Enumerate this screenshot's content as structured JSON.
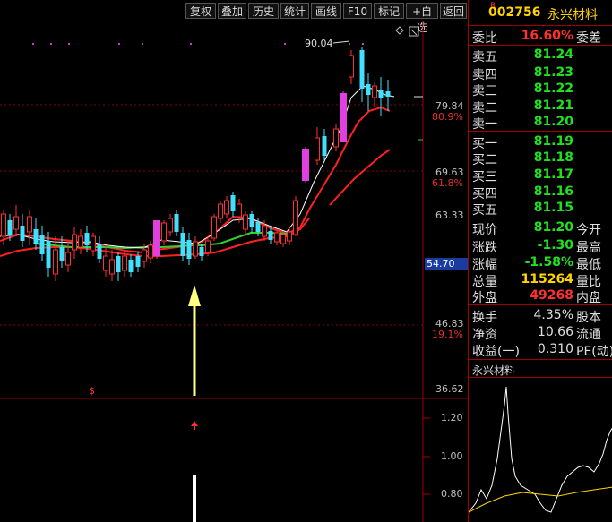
{
  "toolbar": {
    "buttons": [
      "复权",
      "叠加",
      "历史",
      "统计",
      "画线",
      "F10",
      "标记",
      "+自选",
      "返回"
    ]
  },
  "chart": {
    "peak_label": "90.04",
    "axis_labels": [
      {
        "value": "79.84",
        "pct": "80.9%"
      },
      {
        "value": "69.63",
        "pct": "61.8%"
      },
      {
        "value": "63.33",
        "pct": ""
      },
      {
        "value": "46.83",
        "pct": "19.1%"
      },
      {
        "value": "36.62",
        "pct": ""
      }
    ],
    "current_price_tag": "54.70",
    "signal_label": "$",
    "sub_axis": [
      "1.20",
      "1.00",
      "0.80"
    ]
  },
  "quote": {
    "r_mark": "R",
    "code": "002756",
    "name": "永兴材料",
    "wei_bi": {
      "label": "委比",
      "value": "16.60%",
      "tail": "委差"
    },
    "sell": [
      {
        "label": "卖五",
        "price": "81.24"
      },
      {
        "label": "卖四",
        "price": "81.23"
      },
      {
        "label": "卖三",
        "price": "81.22"
      },
      {
        "label": "卖二",
        "price": "81.21"
      },
      {
        "label": "卖一",
        "price": "81.20"
      }
    ],
    "buy": [
      {
        "label": "买一",
        "price": "81.19"
      },
      {
        "label": "买二",
        "price": "81.18"
      },
      {
        "label": "买三",
        "price": "81.17"
      },
      {
        "label": "买四",
        "price": "81.16"
      },
      {
        "label": "买五",
        "price": "81.15"
      }
    ],
    "stats": [
      {
        "label": "现价",
        "value": "81.20",
        "tail": "今开",
        "color": "#20e020"
      },
      {
        "label": "涨跌",
        "value": "-1.30",
        "tail": "最高",
        "color": "#20e020"
      },
      {
        "label": "涨幅",
        "value": "-1.58%",
        "tail": "最低",
        "color": "#20e020"
      },
      {
        "label": "总量",
        "value": "115264",
        "tail": "量比",
        "color": "#ffd400"
      },
      {
        "label": "外盘",
        "value": "49268",
        "tail": "内盘",
        "color": "#ff3030"
      }
    ],
    "fund": [
      {
        "label": "换手",
        "value": "4.35%",
        "tail": "股本"
      },
      {
        "label": "净资",
        "value": "10.66",
        "tail": "流通"
      },
      {
        "label": "收益(一)",
        "value": "0.310",
        "tail": "PE(动)"
      }
    ],
    "mini_title": "永兴材料"
  },
  "colors": {
    "up": "#ff3030",
    "down": "#40e0ff",
    "ma_short": "#ffffff",
    "ma_mid": "#ff2020",
    "ma_green": "#30d030",
    "magenta": "#e040e0"
  }
}
